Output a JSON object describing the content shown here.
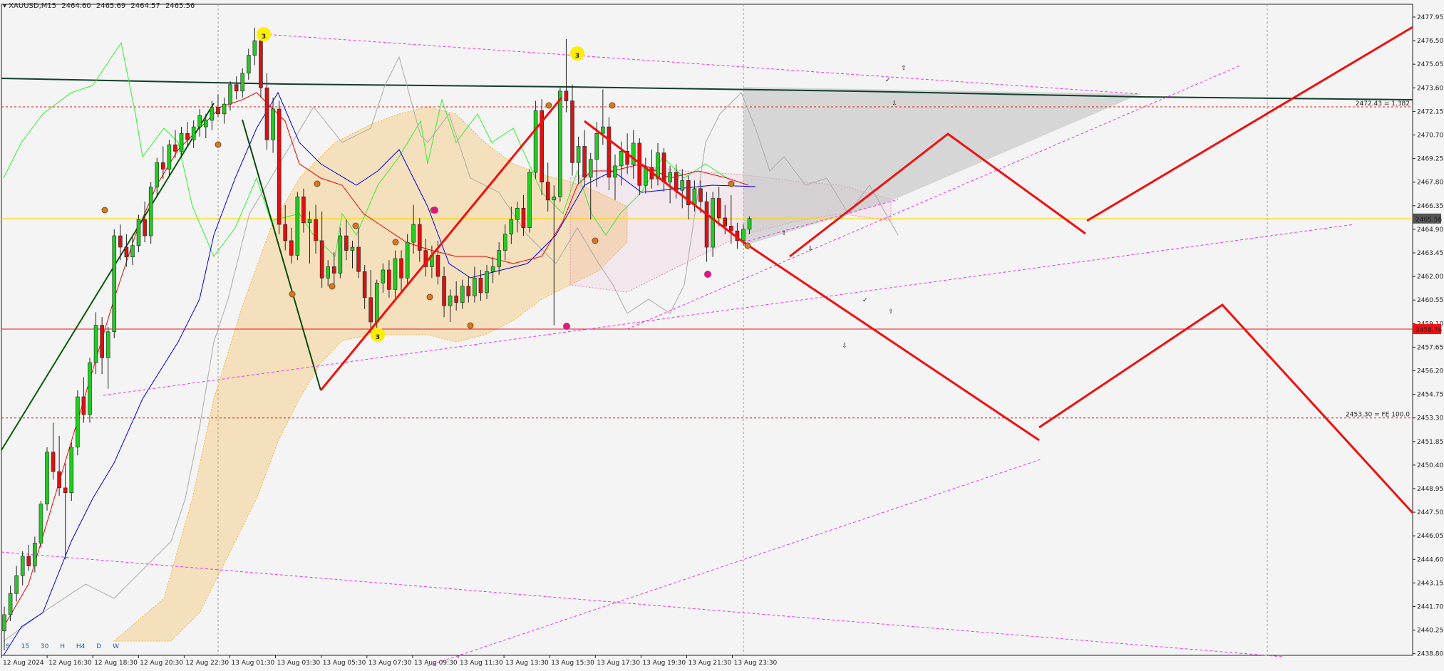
{
  "header": {
    "symbol_label": "▾ XAUUSD,M15",
    "open": "2464.60",
    "high": "2465.69",
    "low": "2464.57",
    "close": "2465.56"
  },
  "timeframes": [
    "S",
    "15",
    "30",
    "H",
    "H4",
    "D",
    "W"
  ],
  "colors": {
    "background": "#f4f4f4",
    "bull_candle": "#22cc22",
    "bear_candle": "#dd1111",
    "wave_lines": "#ee1111",
    "trend_lines": "#ee33ee",
    "kijun": "#0000dd",
    "tenkan": "#ee0000",
    "chikou": "#33ee33",
    "ma_long": "#123d2c",
    "cloud_fill": "#f5b43c",
    "current_price_line": "#ffd400",
    "support_line": "#ee1111"
  },
  "labels": {
    "fib_1382": "2472.43 = 1.382",
    "fe_100": "2453.30 = FE 100.0",
    "current_price_badge": "2465.56",
    "support_badge": "2458.76",
    "wave_3": "3"
  },
  "chart_data": {
    "type": "candlestick",
    "symbol": "XAUUSD",
    "timeframe": "M15",
    "ylim": [
      2438.8,
      2478.6
    ],
    "y_ticks": [
      "2477.95",
      "2476.50",
      "2475.05",
      "2473.60",
      "2472.15",
      "2470.70",
      "2469.25",
      "2467.80",
      "2466.35",
      "2464.90",
      "2463.45",
      "2462.00",
      "2460.55",
      "2459.10",
      "2457.65",
      "2456.20",
      "2454.75",
      "2453.30",
      "2451.85",
      "2450.40",
      "2448.95",
      "2447.50",
      "2446.05",
      "2444.60",
      "2443.15",
      "2441.70",
      "2440.25",
      "2438.80"
    ],
    "x_labels": [
      "12 Aug 2024",
      "12 Aug 16:30",
      "12 Aug 18:30",
      "12 Aug 20:30",
      "12 Aug 22:30",
      "13 Aug 01:30",
      "13 Aug 03:30",
      "13 Aug 05:30",
      "13 Aug 07:30",
      "13 Aug 09:30",
      "13 Aug 11:30",
      "13 Aug 13:30",
      "13 Aug 15:30",
      "13 Aug 17:30",
      "13 Aug 19:30",
      "13 Aug 21:30",
      "13 Aug 23:30"
    ],
    "candles": [
      [
        2440.2,
        2441.7,
        2439.0,
        2441.2
      ],
      [
        2441.2,
        2443.0,
        2440.8,
        2442.5
      ],
      [
        2442.5,
        2444.2,
        2442.0,
        2443.6
      ],
      [
        2443.6,
        2445.1,
        2443.0,
        2444.8
      ],
      [
        2444.8,
        2445.5,
        2443.9,
        2444.2
      ],
      [
        2444.2,
        2446.0,
        2443.8,
        2445.6
      ],
      [
        2445.6,
        2448.2,
        2445.3,
        2448.0
      ],
      [
        2448.0,
        2451.5,
        2447.6,
        2451.2
      ],
      [
        2451.2,
        2453.0,
        2449.5,
        2450.0
      ],
      [
        2450.0,
        2452.2,
        2448.5,
        2449.0
      ],
      [
        2449.0,
        2450.5,
        2444.6,
        2448.7
      ],
      [
        2448.7,
        2451.8,
        2448.2,
        2451.5
      ],
      [
        2451.5,
        2455.0,
        2451.0,
        2454.6
      ],
      [
        2454.6,
        2455.8,
        2453.0,
        2453.5
      ],
      [
        2453.5,
        2457.0,
        2453.0,
        2456.7
      ],
      [
        2456.7,
        2459.8,
        2456.0,
        2459.0
      ],
      [
        2459.0,
        2459.5,
        2456.0,
        2457.0
      ],
      [
        2457.0,
        2458.9,
        2455.1,
        2458.6
      ],
      [
        2458.6,
        2464.9,
        2458.2,
        2464.5
      ],
      [
        2464.5,
        2465.2,
        2463.0,
        2463.8
      ],
      [
        2463.8,
        2464.6,
        2462.6,
        2463.2
      ],
      [
        2463.2,
        2464.4,
        2462.7,
        2463.9
      ],
      [
        2463.9,
        2465.8,
        2463.5,
        2465.5
      ],
      [
        2465.5,
        2466.6,
        2464.1,
        2464.5
      ],
      [
        2464.5,
        2467.8,
        2464.0,
        2467.5
      ],
      [
        2467.5,
        2469.3,
        2466.9,
        2469.0
      ],
      [
        2469.0,
        2470.0,
        2468.0,
        2468.6
      ],
      [
        2468.6,
        2470.4,
        2468.2,
        2470.1
      ],
      [
        2470.1,
        2471.0,
        2469.3,
        2469.7
      ],
      [
        2469.7,
        2471.2,
        2469.3,
        2470.8
      ],
      [
        2470.8,
        2471.5,
        2470.0,
        2470.4
      ],
      [
        2470.4,
        2471.6,
        2469.9,
        2471.2
      ],
      [
        2471.2,
        2472.3,
        2470.6,
        2471.9
      ],
      [
        2471.2,
        2472.0,
        2470.5,
        2471.6
      ],
      [
        2471.6,
        2472.8,
        2471.0,
        2472.4
      ],
      [
        2472.4,
        2473.2,
        2471.8,
        2472.0
      ],
      [
        2472.0,
        2473.0,
        2471.4,
        2472.6
      ],
      [
        2472.6,
        2474.0,
        2472.2,
        2473.8
      ],
      [
        2473.8,
        2474.3,
        2472.9,
        2473.4
      ],
      [
        2473.4,
        2474.8,
        2473.0,
        2474.5
      ],
      [
        2474.5,
        2476.0,
        2474.1,
        2475.6
      ],
      [
        2475.6,
        2477.3,
        2475.0,
        2476.5
      ],
      [
        2476.5,
        2476.8,
        2473.0,
        2473.6
      ],
      [
        2473.6,
        2474.5,
        2469.8,
        2470.4
      ],
      [
        2470.4,
        2473.0,
        2469.6,
        2472.3
      ],
      [
        2472.3,
        2472.8,
        2464.6,
        2465.2
      ],
      [
        2465.2,
        2466.4,
        2463.6,
        2464.2
      ],
      [
        2464.2,
        2465.0,
        2462.8,
        2463.3
      ],
      [
        2463.3,
        2467.2,
        2463.0,
        2466.9
      ],
      [
        2466.9,
        2467.4,
        2464.7,
        2465.3
      ],
      [
        2465.3,
        2466.0,
        2462.8,
        2465.5
      ],
      [
        2465.5,
        2466.4,
        2463.4,
        2464.2
      ],
      [
        2464.2,
        2466.0,
        2461.3,
        2461.9
      ],
      [
        2461.9,
        2463.0,
        2461.4,
        2462.6
      ],
      [
        2462.6,
        2463.5,
        2461.3,
        2462.2
      ],
      [
        2462.2,
        2465.0,
        2461.9,
        2464.5
      ],
      [
        2464.5,
        2465.5,
        2463.0,
        2463.6
      ],
      [
        2463.6,
        2464.2,
        2462.5,
        2463.8
      ],
      [
        2463.8,
        2465.0,
        2461.9,
        2462.3
      ],
      [
        2462.3,
        2462.7,
        2460.0,
        2460.7
      ],
      [
        2460.7,
        2462.4,
        2458.5,
        2459.2
      ],
      [
        2459.2,
        2461.8,
        2458.8,
        2461.6
      ],
      [
        2461.6,
        2462.8,
        2461.0,
        2462.4
      ],
      [
        2462.4,
        2463.0,
        2460.7,
        2461.2
      ],
      [
        2461.2,
        2463.6,
        2460.7,
        2463.1
      ],
      [
        2463.1,
        2463.6,
        2461.0,
        2461.9
      ],
      [
        2461.9,
        2464.6,
        2461.5,
        2464.1
      ],
      [
        2464.1,
        2466.4,
        2463.4,
        2465.2
      ],
      [
        2465.2,
        2465.6,
        2462.9,
        2463.6
      ],
      [
        2463.6,
        2464.3,
        2462.0,
        2462.6
      ],
      [
        2462.6,
        2463.9,
        2461.9,
        2463.3
      ],
      [
        2463.3,
        2464.2,
        2461.5,
        2462.0
      ],
      [
        2462.0,
        2462.6,
        2459.5,
        2460.2
      ],
      [
        2460.2,
        2461.2,
        2459.2,
        2460.8
      ],
      [
        2460.8,
        2461.7,
        2459.9,
        2460.4
      ],
      [
        2460.4,
        2461.8,
        2460.0,
        2461.4
      ],
      [
        2461.4,
        2462.0,
        2460.4,
        2460.8
      ],
      [
        2460.8,
        2462.6,
        2460.4,
        2461.9
      ],
      [
        2461.9,
        2462.4,
        2460.5,
        2461.0
      ],
      [
        2461.0,
        2462.7,
        2460.6,
        2462.3
      ],
      [
        2462.3,
        2463.2,
        2461.6,
        2462.6
      ],
      [
        2462.6,
        2464.1,
        2462.1,
        2463.6
      ],
      [
        2463.6,
        2465.2,
        2463.0,
        2464.6
      ],
      [
        2464.6,
        2466.3,
        2464.0,
        2465.5
      ],
      [
        2465.5,
        2466.6,
        2464.7,
        2466.2
      ],
      [
        2466.2,
        2467.0,
        2464.5,
        2465.0
      ],
      [
        2465.0,
        2468.6,
        2464.7,
        2468.4
      ],
      [
        2468.4,
        2472.8,
        2468.0,
        2472.2
      ],
      [
        2472.2,
        2472.9,
        2467.0,
        2467.8
      ],
      [
        2467.8,
        2469.0,
        2466.0,
        2466.7
      ],
      [
        2466.7,
        2467.6,
        2459.0,
        2466.9
      ],
      [
        2466.9,
        2473.6,
        2466.6,
        2473.4
      ],
      [
        2473.4,
        2476.6,
        2472.1,
        2472.8
      ],
      [
        2472.8,
        2473.8,
        2468.2,
        2469.0
      ],
      [
        2469.0,
        2470.6,
        2467.7,
        2470.0
      ],
      [
        2470.0,
        2471.0,
        2467.5,
        2468.1
      ],
      [
        2468.1,
        2469.6,
        2465.5,
        2469.2
      ],
      [
        2469.2,
        2471.5,
        2467.5,
        2470.8
      ],
      [
        2470.8,
        2473.5,
        2470.1,
        2471.2
      ],
      [
        2471.2,
        2471.8,
        2467.3,
        2468.1
      ],
      [
        2468.1,
        2469.5,
        2466.7,
        2468.8
      ],
      [
        2468.8,
        2470.3,
        2467.6,
        2469.7
      ],
      [
        2469.7,
        2470.8,
        2468.3,
        2468.9
      ],
      [
        2468.9,
        2471.0,
        2468.0,
        2470.2
      ],
      [
        2470.2,
        2470.5,
        2467.0,
        2467.6
      ],
      [
        2467.6,
        2469.3,
        2467.1,
        2468.7
      ],
      [
        2468.7,
        2469.8,
        2467.4,
        2468.0
      ],
      [
        2468.0,
        2470.2,
        2467.6,
        2469.6
      ],
      [
        2469.6,
        2469.9,
        2467.2,
        2467.8
      ],
      [
        2467.8,
        2468.8,
        2466.5,
        2468.4
      ],
      [
        2468.4,
        2468.9,
        2466.8,
        2467.3
      ],
      [
        2467.3,
        2468.6,
        2466.2,
        2467.9
      ],
      [
        2467.9,
        2468.2,
        2465.5,
        2466.4
      ],
      [
        2466.4,
        2467.9,
        2466.0,
        2467.4
      ],
      [
        2467.4,
        2467.9,
        2465.9,
        2466.6
      ],
      [
        2466.6,
        2467.2,
        2462.9,
        2463.8
      ],
      [
        2463.8,
        2467.2,
        2463.2,
        2466.8
      ],
      [
        2466.8,
        2467.5,
        2465.1,
        2465.6
      ],
      [
        2465.6,
        2466.4,
        2464.6,
        2465.1
      ],
      [
        2465.1,
        2467.0,
        2464.0,
        2464.8
      ],
      [
        2464.8,
        2465.3,
        2463.7,
        2464.2
      ],
      [
        2464.2,
        2465.2,
        2463.9,
        2464.9
      ],
      [
        2464.9,
        2465.7,
        2464.6,
        2465.56
      ]
    ]
  }
}
